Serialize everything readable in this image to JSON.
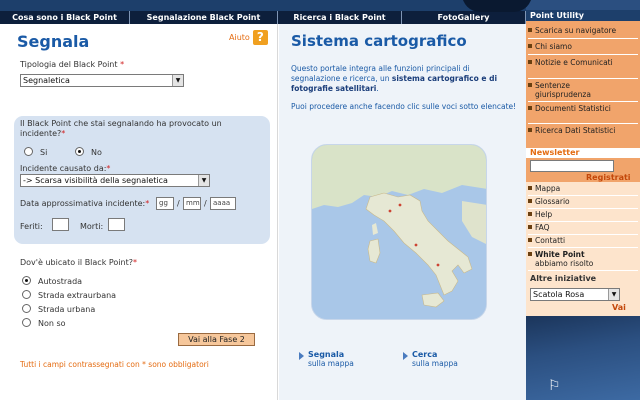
{
  "nav": {
    "items": [
      "Cosa sono i Black Point",
      "Segnalazione Black Point",
      "Ricerca i Black Point",
      "FotoGallery"
    ]
  },
  "form": {
    "title": "Segnala",
    "help_label": "Aiuto",
    "help_icon": "question-mark-icon",
    "tipologia_label": "Tipologia del Black Point",
    "tipologia_value": "Segnaletica",
    "incidente_question": "Il Black Point che stai segnalando ha provocato un incidente?",
    "radio_si": "Si",
    "radio_no": "No",
    "incidente_selected": "No",
    "causa_label": "Incidente causato da:",
    "causa_value": "-> Scarsa visibilità della segnaletica",
    "data_label": "Data approssimativa incidente:",
    "date_placeholders": {
      "day": "gg",
      "month": "mm",
      "year": "aaaa"
    },
    "date_sep": "/",
    "feriti_label": "Feriti:",
    "morti_label": "Morti:",
    "ubicato_label": "Dov'è ubicato il Black Point?",
    "ubicazioni": [
      "Autostrada",
      "Strada extraurbana",
      "Strada urbana",
      "Non so"
    ],
    "ubicazione_selected": "Autostrada",
    "button_label": "Vai alla Fase 2",
    "required_note": "Tutti i campi contrassegnati con * sono obbligatori",
    "required_mark": "*"
  },
  "center": {
    "title": "Sistema cartografico",
    "intro_pre": "Questo portale integra alle funzioni principali di segnalazione e ricerca, un ",
    "intro_bold": "sistema cartografico e di fotografie satellitari",
    "intro_post": ".",
    "para2": "Puoi procedere anche facendo clic sulle voci sotto elencate!",
    "links": [
      {
        "title": "Segnala",
        "sub": "sulla mappa"
      },
      {
        "title": "Cerca",
        "sub": "sulla mappa"
      }
    ]
  },
  "sidebar": {
    "utility_title": "Point Utility",
    "utility_items": [
      "Scarica su navigatore",
      "Chi siamo",
      "Notizie e Comunicati",
      "Sentenze giurisprudenza",
      "Documenti Statistici",
      "Ricerca Dati Statistici"
    ],
    "newsletter_title": "Newsletter",
    "register_label": "Registrati",
    "more_items": [
      "Mappa",
      "Glossario",
      "Help",
      "FAQ",
      "Contatti"
    ],
    "white_point_title": "White Point",
    "white_point_sub": "abbiamo risolto",
    "altre_title": "Altre iniziative",
    "altre_select_value": "Scatola Rosa",
    "vai_label": "Vai"
  },
  "colors": {
    "nav_bg": "#0d1f3c",
    "accent_blue": "#1a5aa6",
    "accent_orange": "#e46c12",
    "sidebar_orange": "#f1a46b"
  }
}
